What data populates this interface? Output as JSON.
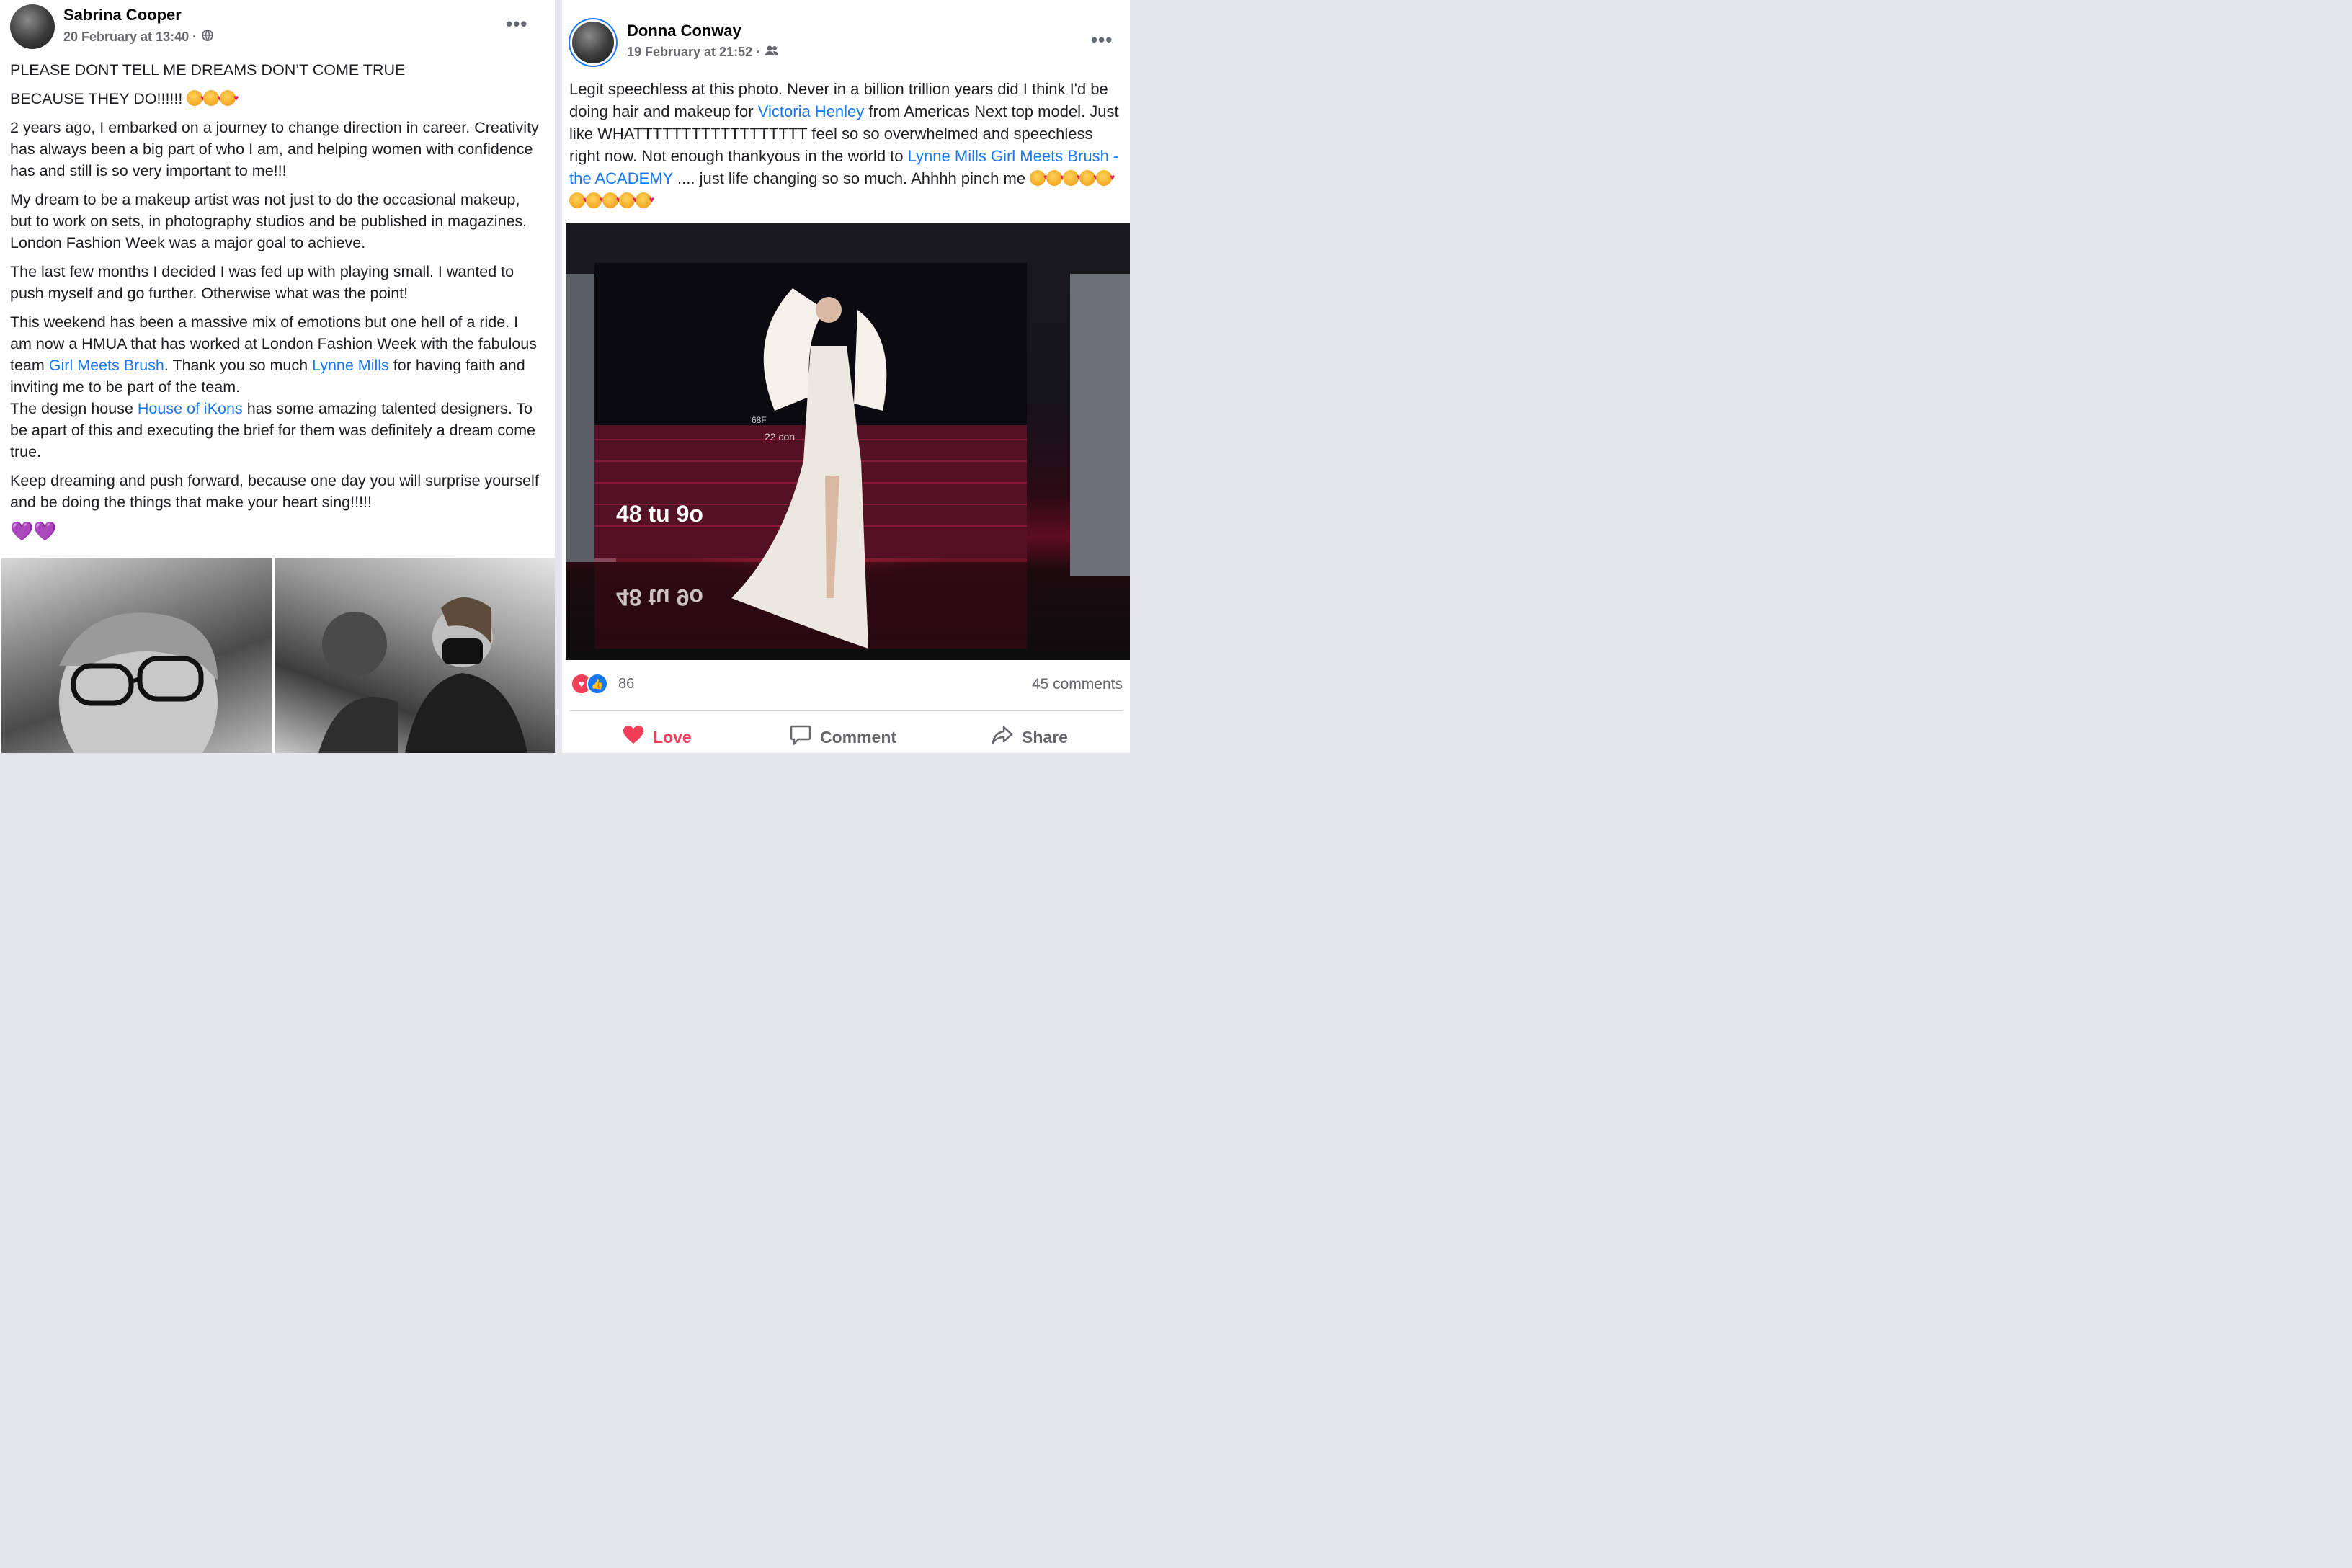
{
  "left_post": {
    "author": "Sabrina Cooper",
    "timestamp": "20 February at 13:40 ·",
    "privacy_icon": "globe-icon",
    "paragraphs": {
      "p1": "PLEASE DONT TELL ME DREAMS DON’T COME TRUE",
      "p2": "BECAUSE THEY DO!!!!!!",
      "p3": "2 years ago, I embarked on a journey to change direction in career. Creativity has always been a big part of who I am, and helping women with confidence has and still is so very important to me!!!",
      "p4": "My dream to be a makeup artist was not just to do the occasional makeup, but to work on sets, in photography studios and be published in magazines. London Fashion Week was a major goal to achieve.",
      "p5": "The last few months I decided I was fed up with playing small. I wanted to push myself and go further. Otherwise what was the point!",
      "p6_a": "This weekend has been a massive mix of emotions but one hell of a ride. I am now a HMUA that has worked at London Fashion Week with the fabulous team ",
      "p6_link1": "Girl Meets Brush",
      "p6_b": ". Thank you so much ",
      "p6_link2": "Lynne Mills",
      "p6_c": " for having faith and inviting me to be part of the team.",
      "p6_d": "The design house ",
      "p6_link3": "House of iKons",
      "p6_e": " has some amazing talented designers. To be apart of this and executing the brief for them was definitely a dream come true.",
      "p7": "Keep dreaming and push forward, because one day you will surprise yourself and be doing the things that make your heart sing!!!!!",
      "hearts": "💜💜"
    },
    "menu_icon": "more-dots-icon"
  },
  "right_post": {
    "author": "Donna Conway",
    "timestamp": "19 February at 21:52 ·",
    "privacy_icon": "friends-icon",
    "text": {
      "a": "Legit speechless at this photo. Never in a billion trillion years did I think I'd be doing hair and makeup for ",
      "link1": "Victoria Henley",
      "b": " from Americas Next top model. Just like WHATTTTTTTTTTTTTTTTTT feel so so overwhelmed and speechless right now. Not enough thankyous in the world to ",
      "link2": "Lynne Mills Girl Meets Brush - the ACADEMY",
      "c": " .... just life changing so so much. Ahhhh pinch me"
    },
    "photo_screen_text": "48 tu 9o",
    "photo_small_text_1": "22 con",
    "photo_small_text_2": "68F",
    "reaction_count": "86",
    "comments_count": "45 comments",
    "actions": {
      "love": "Love",
      "comment": "Comment",
      "share": "Share"
    }
  },
  "colors": {
    "link": "#1877f2",
    "love": "#f33e58",
    "muted": "#65676b"
  }
}
